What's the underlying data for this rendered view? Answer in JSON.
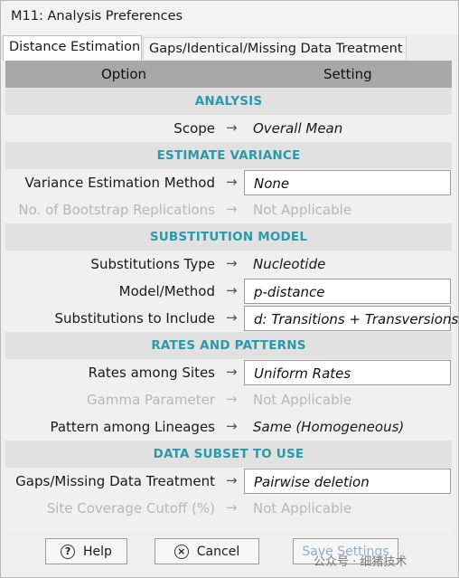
{
  "window": {
    "title": "M11: Analysis Preferences"
  },
  "tabs": [
    "Distance Estimation",
    "Gaps/Identical/Missing Data Treatment"
  ],
  "table": {
    "col_option": "Option",
    "col_setting": "Setting"
  },
  "rows": [
    {
      "type": "section",
      "label": "ANALYSIS"
    },
    {
      "type": "item",
      "option": "Scope",
      "value": "Overall Mean",
      "boxed": false,
      "disabled": false
    },
    {
      "type": "section",
      "label": "ESTIMATE VARIANCE"
    },
    {
      "type": "item",
      "option": "Variance Estimation Method",
      "value": "None",
      "boxed": true,
      "disabled": false
    },
    {
      "type": "item",
      "option": "No. of Bootstrap Replications",
      "value": "Not Applicable",
      "boxed": false,
      "disabled": true
    },
    {
      "type": "section",
      "label": "SUBSTITUTION MODEL"
    },
    {
      "type": "item",
      "option": "Substitutions Type",
      "value": "Nucleotide",
      "boxed": false,
      "disabled": false
    },
    {
      "type": "item",
      "option": "Model/Method",
      "value": "p-distance",
      "boxed": true,
      "disabled": false
    },
    {
      "type": "item",
      "option": "Substitutions to Include",
      "value": "d: Transitions + Transversions",
      "boxed": true,
      "disabled": false
    },
    {
      "type": "section",
      "label": "RATES AND PATTERNS"
    },
    {
      "type": "item",
      "option": "Rates among Sites",
      "value": "Uniform Rates",
      "boxed": true,
      "disabled": false
    },
    {
      "type": "item",
      "option": "Gamma Parameter",
      "value": "Not Applicable",
      "boxed": false,
      "disabled": true
    },
    {
      "type": "item",
      "option": "Pattern among Lineages",
      "value": "Same (Homogeneous)",
      "boxed": false,
      "disabled": false
    },
    {
      "type": "section",
      "label": "DATA SUBSET TO USE"
    },
    {
      "type": "item",
      "option": "Gaps/Missing Data Treatment",
      "value": "Pairwise deletion",
      "boxed": true,
      "disabled": false
    },
    {
      "type": "item",
      "option": "Site Coverage Cutoff (%)",
      "value": "Not Applicable",
      "boxed": false,
      "disabled": true
    }
  ],
  "arrow_glyph": "→",
  "buttons": {
    "help": "Help",
    "cancel": "Cancel",
    "save": "Save Settings"
  },
  "icons": {
    "help": "?",
    "cancel": "×"
  },
  "watermark": "公众号 · 细猪技术",
  "colors": {
    "section_text": "#2b9aa8",
    "header_bg": "#a8a8a8",
    "section_bg": "#e1e1e1"
  }
}
